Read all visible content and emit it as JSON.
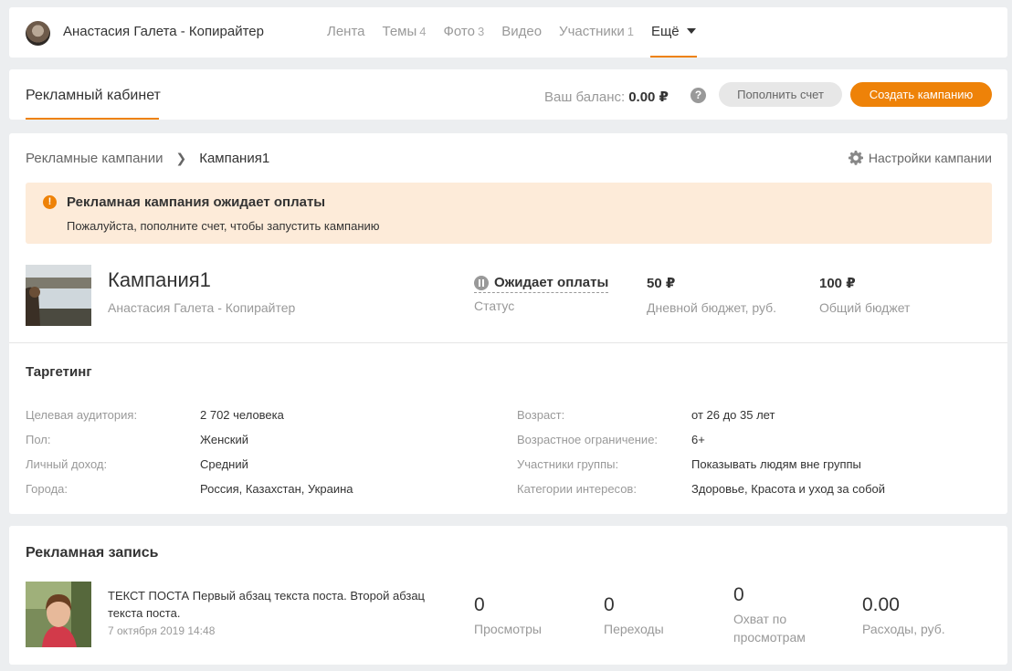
{
  "topnav": {
    "group_name": "Анастасия Галета - Копирайтер",
    "tabs": [
      {
        "label": "Лента",
        "count": ""
      },
      {
        "label": "Темы",
        "count": "4"
      },
      {
        "label": "Фото",
        "count": "3"
      },
      {
        "label": "Видео",
        "count": ""
      },
      {
        "label": "Участники",
        "count": "1"
      },
      {
        "label": "Ещё",
        "count": ""
      }
    ],
    "active_tab": "Ещё"
  },
  "cabinet": {
    "title": "Рекламный кабинет",
    "balance_label": "Ваш баланс:",
    "balance_value": "0.00 ₽",
    "help_icon": "question-circle-icon",
    "topup_label": "Пополнить счет",
    "create_label": "Создать кампанию"
  },
  "colors": {
    "accent": "#ee8208",
    "alert_bg": "#fdebd9"
  },
  "campaign": {
    "breadcrumb_root": "Рекламные кампании",
    "breadcrumb_current": "Кампания1",
    "settings_label": "Настройки кампании",
    "alert": {
      "title": "Рекламная кампания ожидает оплаты",
      "text": "Пожалуйста, пополните счет, чтобы запустить кампанию"
    },
    "name": "Кампания1",
    "owner": "Анастасия Галета - Копирайтер",
    "status_value": "Ожидает оплаты",
    "status_label": "Статус",
    "daily_budget_value": "50 ₽",
    "daily_budget_label": "Дневной бюджет, руб.",
    "total_budget_value": "100 ₽",
    "total_budget_label": "Общий бюджет"
  },
  "targeting": {
    "title": "Таргетинг",
    "left": [
      {
        "label": "Целевая аудитория:",
        "value": "2 702 человека"
      },
      {
        "label": "Пол:",
        "value": "Женский"
      },
      {
        "label": "Личный доход:",
        "value": "Средний"
      },
      {
        "label": "Города:",
        "value": "Россия, Казахстан, Украина"
      }
    ],
    "right": [
      {
        "label": "Возраст:",
        "value": "от 26 до 35 лет"
      },
      {
        "label": "Возрастное ограничение:",
        "value": "6+"
      },
      {
        "label": "Участники группы:",
        "value": "Показывать людям вне группы"
      },
      {
        "label": "Категории интересов:",
        "value": "Здоровье, Красота и уход за собой"
      }
    ]
  },
  "adpost": {
    "title": "Рекламная запись",
    "text": "ТЕКСТ ПОСТА Первый абзац текста поста. Второй абзац текста поста.",
    "date": "7 октября 2019 14:48",
    "metrics": [
      {
        "value": "0",
        "label": "Просмотры"
      },
      {
        "value": "0",
        "label": "Переходы"
      },
      {
        "value": "0",
        "label": "Охват по просмотрам"
      },
      {
        "value": "0.00",
        "label": "Расходы, руб."
      }
    ]
  }
}
